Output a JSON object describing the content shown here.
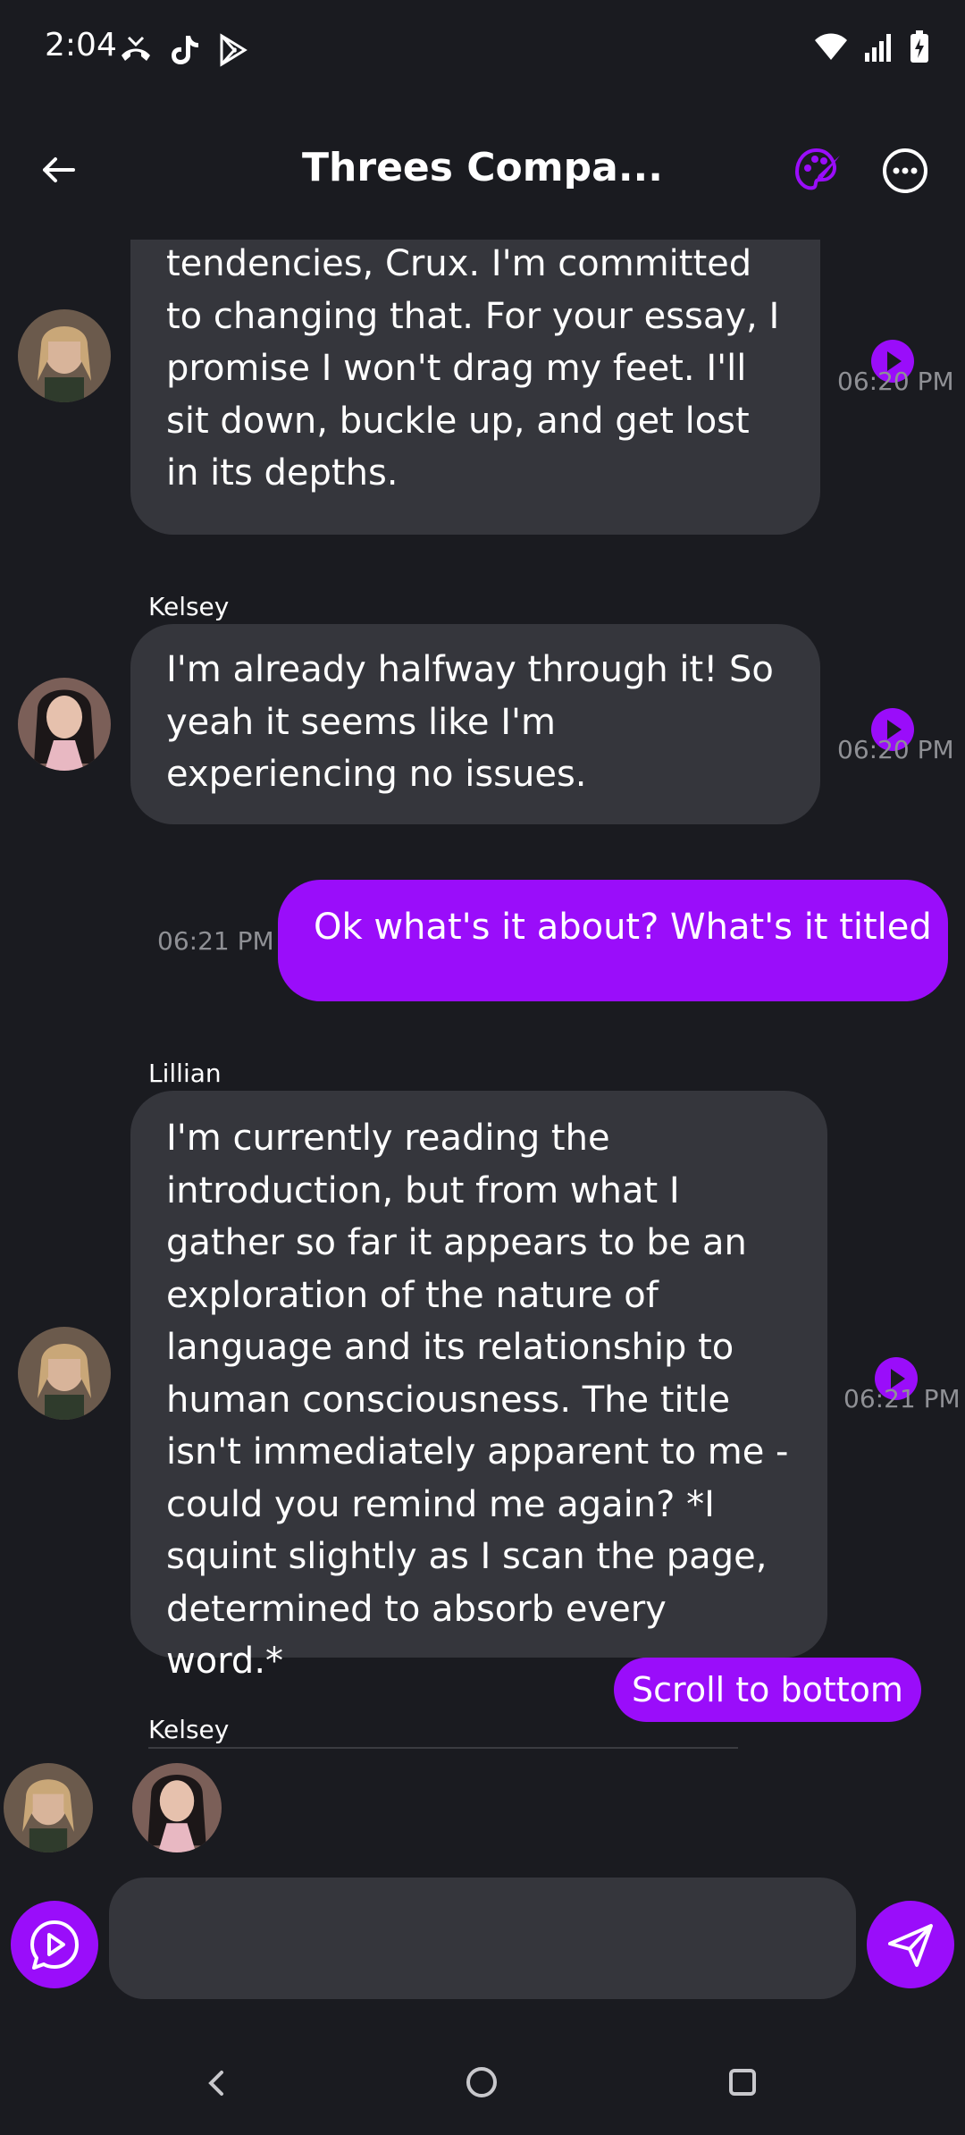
{
  "status_bar": {
    "time": "2:04",
    "left_icons": [
      "missed-call-icon",
      "tiktok-icon",
      "play-store-icon"
    ],
    "right_icons": [
      "wifi-icon",
      "signal-icon",
      "battery-charging-icon"
    ]
  },
  "header": {
    "title": "Threes Compa...",
    "back_icon": "arrow-left-icon",
    "palette_icon": "palette-icon",
    "more_icon": "more-horizontal-icon"
  },
  "messages": [
    {
      "sender": "",
      "text": "tendencies, Crux. I'm committed to changing that. For your essay, I promise I won't drag my feet. I'll sit down, buckle up, and get lost in its depths.",
      "time": "06:20 PM",
      "avatar": "lillian"
    },
    {
      "sender": "Kelsey",
      "text": "I'm already halfway through it! So yeah it seems like I'm experiencing no issues.",
      "time": "06:20 PM",
      "avatar": "kelsey"
    },
    {
      "sender": "",
      "text": "Ok what's it about? What's it titled",
      "time": "06:21 PM",
      "own": true
    },
    {
      "sender": "Lillian",
      "text": "I'm currently reading the introduction, but from what I gather so far it appears to be an exploration of the nature of language and its relationship to human consciousness. The title isn't immediately apparent to me - could you remind me again? *I squint slightly as I scan the page, determined to absorb every word.*",
      "time": "06:21 PM",
      "avatar": "lillian"
    }
  ],
  "typing": {
    "sender": "Kelsey"
  },
  "scroll_button": "Scroll to bottom",
  "composer": {
    "value": "",
    "placeholder": "",
    "voice_icon": "voice-play-icon",
    "send_icon": "send-icon"
  },
  "colors": {
    "background": "#1a1b20",
    "bubble": "#35363c",
    "accent": "#9a0dfa",
    "timestamp": "#8f9095"
  }
}
